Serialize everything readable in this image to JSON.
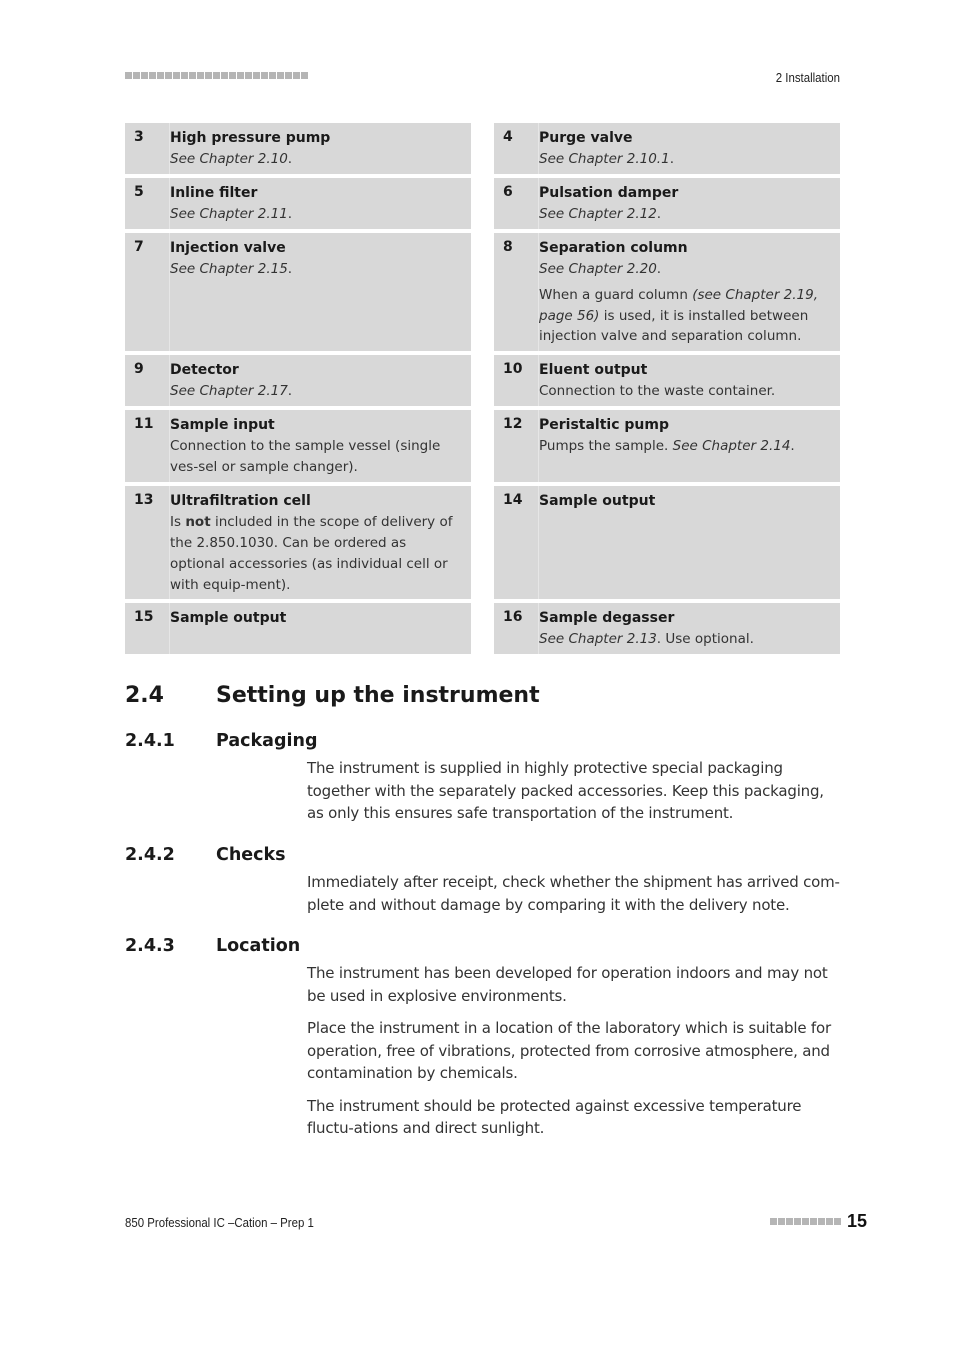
{
  "header": {
    "chapter": "2 Installation",
    "decor_squares": 23
  },
  "legend": [
    [
      {
        "num": "3",
        "title": "High pressure pump",
        "desc_italic": "See Chapter 2.10",
        "desc_plain": ".",
        "extra": ""
      },
      {
        "num": "4",
        "title": "Purge valve",
        "desc_italic": "See Chapter 2.10.1",
        "desc_plain": ".",
        "extra": ""
      }
    ],
    [
      {
        "num": "5",
        "title": "Inline filter",
        "desc_italic": "See Chapter 2.11",
        "desc_plain": ".",
        "extra": ""
      },
      {
        "num": "6",
        "title": "Pulsation damper",
        "desc_italic": "See Chapter 2.12",
        "desc_plain": ".",
        "extra": ""
      }
    ],
    [
      {
        "num": "7",
        "title": "Injection valve",
        "desc_italic": "See Chapter 2.15",
        "desc_plain": ".",
        "extra": ""
      },
      {
        "num": "8",
        "title": "Separation column",
        "desc_italic": "See Chapter 2.20",
        "desc_plain": ".",
        "extra_parts": [
          {
            "text": "When a guard column ",
            "italic": false
          },
          {
            "text": "(see Chapter 2.19, page 56)",
            "italic": true
          },
          {
            "text": " is used, it is installed between injection valve and separation column.",
            "italic": false
          }
        ]
      }
    ],
    [
      {
        "num": "9",
        "title": "Detector",
        "desc_italic": "See Chapter 2.17",
        "desc_plain": ".",
        "extra": ""
      },
      {
        "num": "10",
        "title": "Eluent output",
        "desc_prefix": "Connection to the waste container.",
        "desc_italic": "",
        "desc_plain": "",
        "extra": ""
      }
    ],
    [
      {
        "num": "11",
        "title": "Sample input",
        "desc_prefix": "Connection to the sample vessel (single ves-sel or sample changer).",
        "desc_italic": "",
        "desc_plain": "",
        "extra": ""
      },
      {
        "num": "12",
        "title": "Peristaltic pump",
        "desc_prefix": "Pumps the sample. ",
        "desc_italic": "See Chapter 2.14",
        "desc_plain": ".",
        "extra": ""
      }
    ],
    [
      {
        "num": "13",
        "title": "Ultrafiltration cell",
        "desc_prefix": "Is ",
        "desc_bold": "not",
        "desc_after_bold": " included in the scope of delivery of the 2.850.1030. Can be ordered as optional accessories (as individual cell or with equip-ment).",
        "desc_italic": "",
        "desc_plain": "",
        "extra": ""
      },
      {
        "num": "14",
        "title": "Sample output",
        "desc_italic": "",
        "desc_plain": "",
        "extra": ""
      }
    ],
    [
      {
        "num": "15",
        "title": "Sample output",
        "desc_italic": "",
        "desc_plain": "",
        "extra": ""
      },
      {
        "num": "16",
        "title": "Sample degasser",
        "desc_italic": "See Chapter 2.13",
        "desc_plain": ". Use optional.",
        "extra": ""
      }
    ]
  ],
  "section": {
    "number": "2.4",
    "title": "Setting up the instrument",
    "subsections": [
      {
        "number": "2.4.1",
        "title": "Packaging",
        "paragraphs": [
          "The instrument is supplied in highly protective special packaging together with the separately packed accessories. Keep this packaging, as only this ensures safe transportation of the instrument."
        ]
      },
      {
        "number": "2.4.2",
        "title": "Checks",
        "paragraphs": [
          "Immediately after receipt, check whether the shipment has arrived com-plete and without damage by comparing it with the delivery note."
        ]
      },
      {
        "number": "2.4.3",
        "title": "Location",
        "paragraphs": [
          "The instrument has been developed for operation indoors and may not be used in explosive environments.",
          "Place the instrument in a location of the laboratory which is suitable for operation, free of vibrations, protected from corrosive atmosphere, and contamination by chemicals.",
          "The instrument should be protected against excessive temperature fluctu-ations and direct sunlight."
        ]
      }
    ]
  },
  "footer": {
    "product": "850 Professional IC –Cation – Prep 1",
    "page_number": "15",
    "decor_squares": 9
  }
}
